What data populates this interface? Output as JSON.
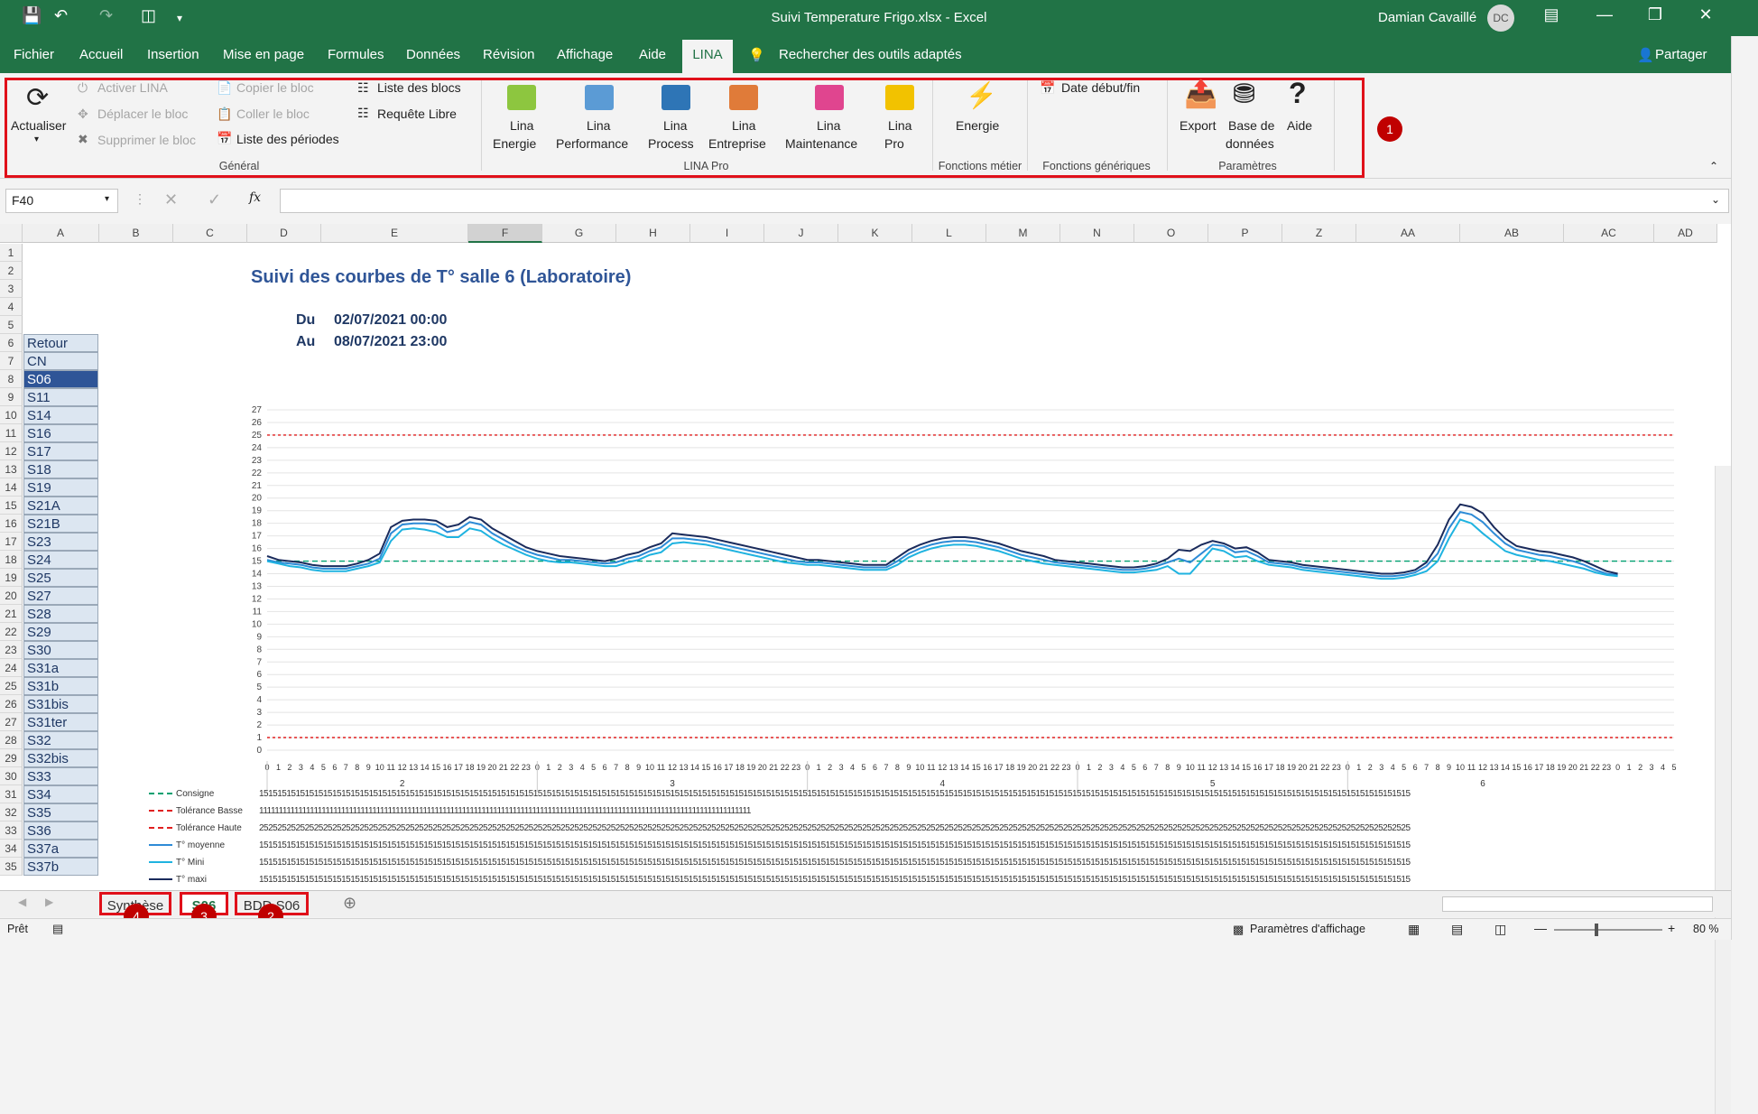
{
  "window": {
    "title": "Suivi Temperature Frigo.xlsx  -  Excel",
    "user": "Damian Cavaillé",
    "initials": "DC"
  },
  "menu": {
    "items": [
      "Fichier",
      "Accueil",
      "Insertion",
      "Mise en page",
      "Formules",
      "Données",
      "Révision",
      "Affichage",
      "Aide"
    ],
    "active_tab": "LINA",
    "search": "Rechercher des outils adaptés",
    "share": "Partager"
  },
  "ribbon": {
    "actualiser": "Actualiser",
    "activer": "Activer LINA",
    "deplacer": "Déplacer le bloc",
    "supprimer": "Supprimer le bloc",
    "copier": "Copier le bloc",
    "coller": "Coller le bloc",
    "liste_periodes": "Liste des périodes",
    "liste_blocs": "Liste des blocs",
    "requete": "Requête Libre",
    "group_general": "Général",
    "lina_items": [
      {
        "l1": "Lina",
        "l2": "Energie",
        "color": "#8dc63f"
      },
      {
        "l1": "Lina",
        "l2": "Performance",
        "color": "#5b9bd5"
      },
      {
        "l1": "Lina",
        "l2": "Process",
        "color": "#2e75b6"
      },
      {
        "l1": "Lina",
        "l2": "Entreprise",
        "color": "#e07b39"
      },
      {
        "l1": "Lina",
        "l2": "Maintenance",
        "color": "#e0458f"
      },
      {
        "l1": "Lina",
        "l2": "Pro",
        "color": "#f2c200"
      }
    ],
    "group_lina_pro": "LINA Pro",
    "energie": "Energie",
    "group_metier": "Fonctions métier",
    "date_debut": "Date début/fin",
    "group_generiques": "Fonctions génériques",
    "export": "Export",
    "base1": "Base de",
    "base2": "données",
    "aide": "Aide",
    "group_parametres": "Paramètres"
  },
  "formula": {
    "namebox": "F40",
    "fx": "fx"
  },
  "columns": [
    "A",
    "B",
    "C",
    "D",
    "E",
    "F",
    "G",
    "H",
    "I",
    "J",
    "K",
    "L",
    "M",
    "N",
    "O",
    "P",
    "Z",
    "AA",
    "AB",
    "AC",
    "AD"
  ],
  "rows": [
    "1",
    "2",
    "3",
    "4",
    "5",
    "6",
    "7",
    "8",
    "9",
    "10",
    "11",
    "12",
    "13",
    "14",
    "15",
    "16",
    "17",
    "18",
    "19",
    "20",
    "21",
    "22",
    "23",
    "24",
    "25",
    "26",
    "27",
    "28",
    "29",
    "30",
    "31",
    "32",
    "33",
    "34",
    "35"
  ],
  "sheet": {
    "title": "Suivi des courbes de T° salle 6 (Laboratoire)",
    "du_label": "Du",
    "du_value": "02/07/2021 00:00",
    "au_label": "Au",
    "au_value": "08/07/2021 23:00",
    "nav": [
      "Retour",
      "CN",
      "S06",
      "S11",
      "S14",
      "S16",
      "S17",
      "S18",
      "S19",
      "S21A",
      "S21B",
      "S23",
      "S24",
      "S25",
      "S27",
      "S28",
      "S29",
      "S30",
      "S31a",
      "S31b",
      "S31bis",
      "S31ter",
      "S32",
      "S32bis",
      "S33",
      "S34",
      "S35",
      "S36",
      "S37a",
      "S37b"
    ],
    "nav_selected": "S06"
  },
  "chart_data": {
    "type": "line",
    "title": "",
    "xlabel": "",
    "ylabel": "",
    "ylim": [
      0,
      27
    ],
    "yticks": [
      "0",
      "1",
      "2",
      "3",
      "4",
      "5",
      "6",
      "7",
      "8",
      "9",
      "10",
      "11",
      "12",
      "13",
      "14",
      "15",
      "16",
      "17",
      "18",
      "19",
      "20",
      "21",
      "22",
      "23",
      "24",
      "25",
      "26",
      "27"
    ],
    "day_labels": [
      "2",
      "3",
      "4",
      "5",
      "6"
    ],
    "hours_per_day": 24,
    "x_hours": [
      "0",
      "1",
      "2",
      "3",
      "4",
      "5",
      "6",
      "7",
      "8",
      "9",
      "10",
      "11",
      "12",
      "13",
      "14",
      "15",
      "16",
      "17",
      "18",
      "19",
      "20",
      "21",
      "22",
      "23"
    ],
    "series": [
      {
        "name": "Consigne",
        "color": "#00a070",
        "dash": "6,4",
        "values": [
          15,
          15,
          15,
          15,
          15,
          15,
          15,
          15,
          15,
          15,
          15,
          15,
          15,
          15,
          15,
          15,
          15,
          15,
          15,
          15,
          15,
          15,
          15,
          15,
          15,
          15,
          15,
          15,
          15,
          15,
          15,
          15,
          15,
          15,
          15,
          15,
          15,
          15,
          15,
          15,
          15,
          15,
          15,
          15,
          15,
          15,
          15,
          15,
          15,
          15,
          15,
          15,
          15,
          15,
          15,
          15,
          15,
          15,
          15,
          15,
          15,
          15,
          15,
          15,
          15,
          15,
          15,
          15,
          15,
          15,
          15,
          15,
          15,
          15,
          15,
          15,
          15,
          15,
          15,
          15,
          15,
          15,
          15,
          15,
          15,
          15,
          15,
          15,
          15,
          15,
          15,
          15,
          15,
          15,
          15,
          15,
          15,
          15,
          15,
          15,
          15,
          15,
          15,
          15,
          15,
          15,
          15,
          15,
          15,
          15,
          15,
          15,
          15,
          15,
          15,
          15,
          15,
          15,
          15,
          15,
          15,
          15,
          15,
          15,
          15,
          15
        ]
      },
      {
        "name": "Tolérance Basse",
        "color": "#e02020",
        "dash": "3,3",
        "values": [
          1,
          1,
          1,
          1,
          1,
          1,
          1,
          1,
          1,
          1,
          1,
          1,
          1,
          1,
          1,
          1,
          1,
          1,
          1,
          1,
          1,
          1,
          1,
          1,
          1,
          1,
          1,
          1,
          1,
          1,
          1,
          1,
          1,
          1,
          1,
          1,
          1,
          1,
          1,
          1,
          1,
          1,
          1,
          1,
          1,
          1,
          1,
          1,
          1,
          1,
          1,
          1,
          1,
          1,
          1,
          1,
          1,
          1,
          1,
          1,
          1,
          1,
          1,
          1,
          1,
          1,
          1,
          1,
          1,
          1,
          1,
          1,
          1,
          1,
          1,
          1,
          1,
          1,
          1,
          1,
          1,
          1,
          1,
          1,
          1,
          1,
          1,
          1,
          1,
          1,
          1,
          1,
          1,
          1,
          1,
          1,
          1,
          1,
          1,
          1,
          1,
          1,
          1,
          1,
          1,
          1,
          1,
          1,
          1,
          1,
          1,
          1,
          1,
          1,
          1,
          1,
          1,
          1,
          1,
          1,
          1,
          1,
          1,
          1,
          1,
          1
        ]
      },
      {
        "name": "Tolérance Haute",
        "color": "#e02020",
        "dash": "3,3",
        "values": [
          25,
          25,
          25,
          25,
          25,
          25,
          25,
          25,
          25,
          25,
          25,
          25,
          25,
          25,
          25,
          25,
          25,
          25,
          25,
          25,
          25,
          25,
          25,
          25,
          25,
          25,
          25,
          25,
          25,
          25,
          25,
          25,
          25,
          25,
          25,
          25,
          25,
          25,
          25,
          25,
          25,
          25,
          25,
          25,
          25,
          25,
          25,
          25,
          25,
          25,
          25,
          25,
          25,
          25,
          25,
          25,
          25,
          25,
          25,
          25,
          25,
          25,
          25,
          25,
          25,
          25,
          25,
          25,
          25,
          25,
          25,
          25,
          25,
          25,
          25,
          25,
          25,
          25,
          25,
          25,
          25,
          25,
          25,
          25,
          25,
          25,
          25,
          25,
          25,
          25,
          25,
          25,
          25,
          25,
          25,
          25,
          25,
          25,
          25,
          25,
          25,
          25,
          25,
          25,
          25,
          25,
          25,
          25,
          25,
          25,
          25,
          25,
          25,
          25,
          25,
          25,
          25,
          25,
          25,
          25,
          25,
          25,
          25,
          25,
          25,
          25
        ]
      },
      {
        "name": "T° moyenne",
        "color": "#2e8bd6",
        "dash": "",
        "values": [
          15.1,
          14.9,
          14.8,
          14.7,
          14.5,
          14.4,
          14.4,
          14.4,
          14.6,
          14.8,
          15.2,
          17.2,
          17.9,
          18.0,
          18.0,
          17.9,
          17.3,
          17.5,
          18.1,
          17.9,
          17.2,
          16.7,
          16.2,
          15.8,
          15.5,
          15.3,
          15.1,
          15.1,
          15.0,
          14.9,
          14.8,
          14.9,
          15.2,
          15.4,
          15.8,
          16.1,
          16.8,
          16.8,
          16.7,
          16.6,
          16.4,
          16.2,
          16.0,
          15.8,
          15.6,
          15.4,
          15.2,
          15.0,
          14.9,
          14.9,
          14.8,
          14.7,
          14.6,
          14.5,
          14.5,
          14.5,
          15.0,
          15.6,
          16.0,
          16.3,
          16.5,
          16.6,
          16.6,
          16.5,
          16.3,
          16.1,
          15.8,
          15.5,
          15.3,
          15.1,
          14.9,
          14.8,
          14.7,
          14.6,
          14.5,
          14.4,
          14.3,
          14.3,
          14.4,
          14.6,
          14.9,
          15.2,
          14.9,
          15.6,
          16.3,
          16.2,
          15.7,
          15.8,
          15.4,
          14.9,
          14.8,
          14.7,
          14.5,
          14.4,
          14.3,
          14.2,
          14.1,
          14.0,
          13.9,
          13.8,
          13.8,
          13.9,
          14.1,
          14.6,
          15.6,
          17.6,
          18.9,
          18.7,
          18.1,
          17.2,
          16.4,
          15.9,
          15.7,
          15.5,
          15.4,
          15.2,
          15.0,
          14.7,
          14.3,
          14.0,
          13.9
        ]
      },
      {
        "name": "T° Mini",
        "color": "#1fb3e0",
        "dash": "",
        "values": [
          15,
          14.8,
          14.6,
          14.5,
          14.3,
          14.2,
          14.2,
          14.2,
          14.4,
          14.6,
          14.9,
          16.6,
          17.5,
          17.6,
          17.5,
          17.3,
          16.9,
          16.9,
          17.6,
          17.4,
          16.8,
          16.3,
          15.9,
          15.5,
          15.2,
          15.0,
          14.9,
          14.9,
          14.8,
          14.7,
          14.6,
          14.6,
          14.9,
          15.1,
          15.5,
          15.7,
          16.4,
          16.5,
          16.4,
          16.3,
          16.1,
          15.9,
          15.7,
          15.5,
          15.3,
          15.1,
          14.9,
          14.8,
          14.7,
          14.7,
          14.6,
          14.5,
          14.4,
          14.3,
          14.3,
          14.3,
          14.7,
          15.3,
          15.7,
          16.0,
          16.2,
          16.3,
          16.3,
          16.2,
          16.0,
          15.8,
          15.5,
          15.2,
          15.0,
          14.8,
          14.7,
          14.6,
          14.5,
          14.4,
          14.3,
          14.2,
          14.1,
          14.1,
          14.2,
          14.3,
          14.6,
          14.0,
          14.0,
          15.0,
          16.0,
          15.8,
          15.3,
          15.4,
          15.0,
          14.7,
          14.6,
          14.5,
          14.3,
          14.2,
          14.1,
          14.0,
          13.9,
          13.8,
          13.7,
          13.6,
          13.6,
          13.7,
          13.9,
          14.2,
          15.0,
          16.8,
          18.3,
          18.0,
          17.2,
          16.5,
          15.8,
          15.5,
          15.3,
          15.1,
          15.0,
          14.8,
          14.6,
          14.4,
          14.1,
          13.9,
          13.8
        ]
      },
      {
        "name": "T° maxi",
        "color": "#1a2b5c",
        "dash": "",
        "values": [
          15.4,
          15.1,
          15.0,
          14.9,
          14.7,
          14.6,
          14.6,
          14.6,
          14.8,
          15.1,
          15.6,
          17.7,
          18.2,
          18.3,
          18.3,
          18.2,
          17.7,
          17.9,
          18.5,
          18.3,
          17.6,
          17.1,
          16.6,
          16.1,
          15.8,
          15.6,
          15.4,
          15.3,
          15.2,
          15.1,
          15.0,
          15.2,
          15.5,
          15.7,
          16.1,
          16.4,
          17.2,
          17.1,
          17.0,
          16.9,
          16.7,
          16.5,
          16.3,
          16.1,
          15.9,
          15.7,
          15.5,
          15.3,
          15.1,
          15.1,
          15.0,
          14.9,
          14.8,
          14.7,
          14.7,
          14.7,
          15.3,
          15.9,
          16.3,
          16.6,
          16.8,
          16.9,
          16.9,
          16.8,
          16.6,
          16.4,
          16.1,
          15.8,
          15.6,
          15.4,
          15.1,
          15.0,
          14.9,
          14.8,
          14.7,
          14.6,
          14.5,
          14.5,
          14.6,
          14.8,
          15.2,
          15.9,
          15.8,
          16.3,
          16.6,
          16.4,
          16.0,
          16.1,
          15.7,
          15.1,
          15.0,
          14.9,
          14.7,
          14.6,
          14.5,
          14.4,
          14.3,
          14.2,
          14.1,
          14.0,
          14.0,
          14.1,
          14.3,
          14.9,
          16.3,
          18.3,
          19.5,
          19.3,
          18.8,
          17.7,
          16.8,
          16.2,
          16.0,
          15.8,
          15.7,
          15.5,
          15.3,
          15.0,
          14.6,
          14.2,
          14.0
        ]
      }
    ],
    "table_rows": [
      {
        "name": "Consigne",
        "value": "15"
      },
      {
        "name": "Tolérance Basse",
        "value": "1"
      },
      {
        "name": "Tolérance Haute",
        "value": "25"
      },
      {
        "name": "T° moyenne",
        "value": "15"
      },
      {
        "name": "T° Mini",
        "value": "15"
      },
      {
        "name": "T° maxi",
        "value": "15"
      }
    ]
  },
  "sheets": {
    "tabs": [
      "Synthèse",
      "S06",
      "BDD S06"
    ],
    "active": "S06",
    "badges": [
      "4",
      "3",
      "2"
    ]
  },
  "ribbon_badge": "1",
  "status": {
    "ready": "Prêt",
    "display_settings": "Paramètres d'affichage",
    "zoom": "80 %"
  }
}
